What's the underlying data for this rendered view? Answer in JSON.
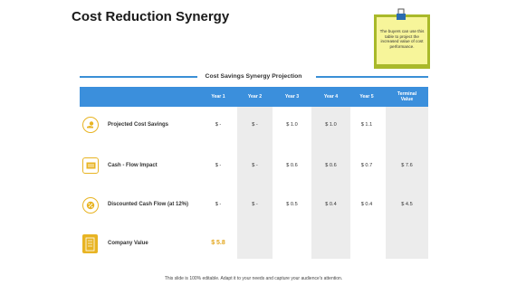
{
  "slide": {
    "title": "Cost Reduction Synergy",
    "note_text": "The buyers can use this table to project the increased value of cost performance.",
    "section_title": "Cost Savings Synergy Projection",
    "footer": "This slide is 100% editable. Adapt it to your needs and capture your audience's attention."
  },
  "table": {
    "headers": [
      "Year 1",
      "Year 2",
      "Year 3",
      "Year 4",
      "Year 5",
      "Terminal Value"
    ],
    "rows": [
      {
        "label": "Projected Cost Savings",
        "icon": "hand-coin-icon",
        "values": [
          "$ -",
          "$ -",
          "$ 1.0",
          "$ 1.0",
          "$ 1.1",
          ""
        ]
      },
      {
        "label": "Cash - Flow Impact",
        "icon": "cash-flow-icon",
        "values": [
          "$ -",
          "$ -",
          "$ 0.6",
          "$ 0.6",
          "$ 0.7",
          "$ 7.6"
        ]
      },
      {
        "label": "Discounted Cash Flow (at 12%)",
        "icon": "discount-icon",
        "values": [
          "$ -",
          "$ -",
          "$ 0.5",
          "$ 0.4",
          "$ 0.4",
          "$ 4.5"
        ]
      },
      {
        "label": "Company Value",
        "icon": "building-icon",
        "values": [
          "$ 5.8",
          "",
          "",
          "",
          "",
          ""
        ]
      }
    ]
  },
  "colors": {
    "header_blue": "#3b8fdc",
    "accent_yellow": "#e8b423",
    "note_green": "#a9b92a",
    "note_yellow": "#f7f59a",
    "shade_gray": "#ececec"
  }
}
